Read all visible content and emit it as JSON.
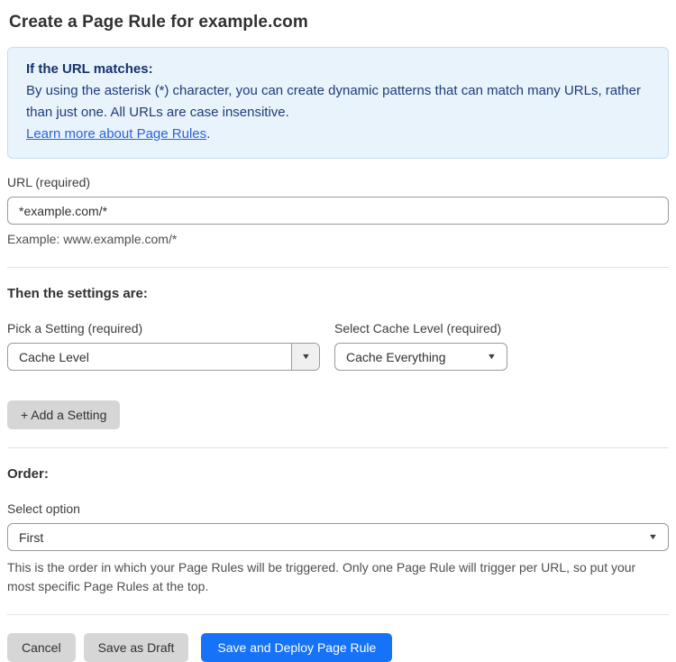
{
  "page": {
    "title": "Create a Page Rule for example.com"
  },
  "info_box": {
    "heading": "If the URL matches:",
    "body": "By using the asterisk (*) character, you can create dynamic patterns that can match many URLs, rather than just one. All URLs are case insensitive.",
    "link_text": "Learn more about Page Rules",
    "link_suffix": "."
  },
  "url_field": {
    "label": "URL (required)",
    "value": "*example.com/*",
    "example": "Example: www.example.com/*"
  },
  "settings_section": {
    "heading": "Then the settings are:",
    "setting_picker": {
      "label": "Pick a Setting (required)",
      "selected": "Cache Level"
    },
    "cache_level_picker": {
      "label": "Select Cache Level (required)",
      "selected": "Cache Everything"
    },
    "add_setting_label": "+ Add a Setting"
  },
  "order_section": {
    "heading": "Order:",
    "select_label": "Select option",
    "selected": "First",
    "help": "This is the order in which your Page Rules will be triggered. Only one Page Rule will trigger per URL, so put your most specific Page Rules at the top."
  },
  "footer": {
    "cancel_label": "Cancel",
    "save_draft_label": "Save as Draft",
    "save_deploy_label": "Save and Deploy Page Rule"
  },
  "colors": {
    "accent_blue": "#1672f6",
    "info_background": "#e9f3fc",
    "info_border": "#c6ddf2",
    "info_text": "#1e3c78",
    "link_blue": "#2c62d9"
  },
  "icons": {
    "dropdown_arrow": "▼"
  }
}
